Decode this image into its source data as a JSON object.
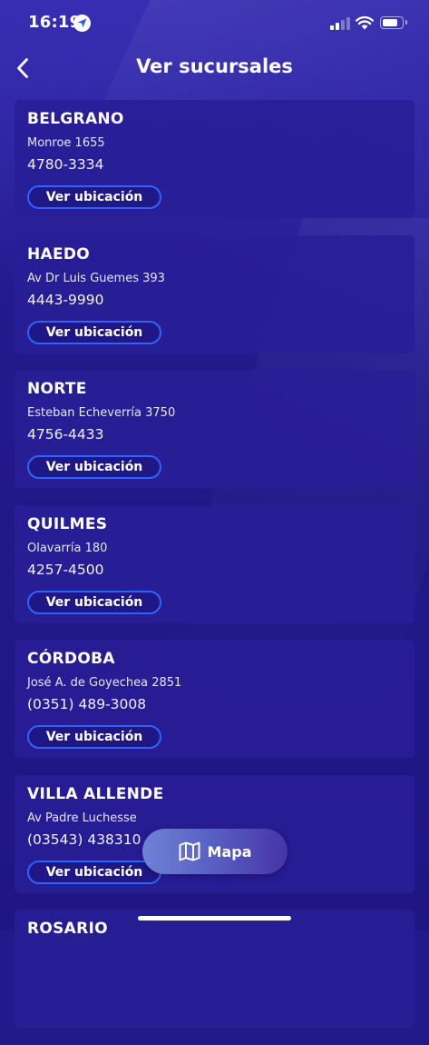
{
  "status_bar": {
    "time": "16:19"
  },
  "header": {
    "title": "Ver sucursales"
  },
  "branches": [
    {
      "name": "BELGRANO",
      "address": "Monroe 1655",
      "phone": "4780-3334",
      "button": "Ver ubicación"
    },
    {
      "name": "HAEDO",
      "address": "Av Dr Luis Guemes 393",
      "phone": "4443-9990",
      "button": "Ver ubicación"
    },
    {
      "name": "NORTE",
      "address": "Esteban Echeverría 3750",
      "phone": "4756-4433",
      "button": "Ver ubicación"
    },
    {
      "name": "QUILMES",
      "address": "Olavarría 180",
      "phone": "4257-4500",
      "button": "Ver ubicación"
    },
    {
      "name": "CÓRDOBA",
      "address": "José A. de Goyechea 2851",
      "phone": "(0351) 489-3008",
      "button": "Ver ubicación"
    },
    {
      "name": "VILLA ALLENDE",
      "address": "Av Padre Luchesse",
      "phone": "(03543) 438310",
      "button": "Ver ubicación"
    },
    {
      "name": "ROSARIO",
      "address": "",
      "phone": "",
      "button": ""
    }
  ],
  "map_button": {
    "label": "Mapa"
  },
  "icons": {
    "back": "chevron-left-icon",
    "map": "map-icon",
    "location": "location-arrow-icon",
    "signal": "cellular-signal-icon",
    "wifi": "wifi-icon",
    "battery": "battery-icon"
  },
  "colors": {
    "background": "#22198a",
    "card": "#281e96",
    "button_border": "#2f63ff",
    "text": "#ffffff"
  }
}
